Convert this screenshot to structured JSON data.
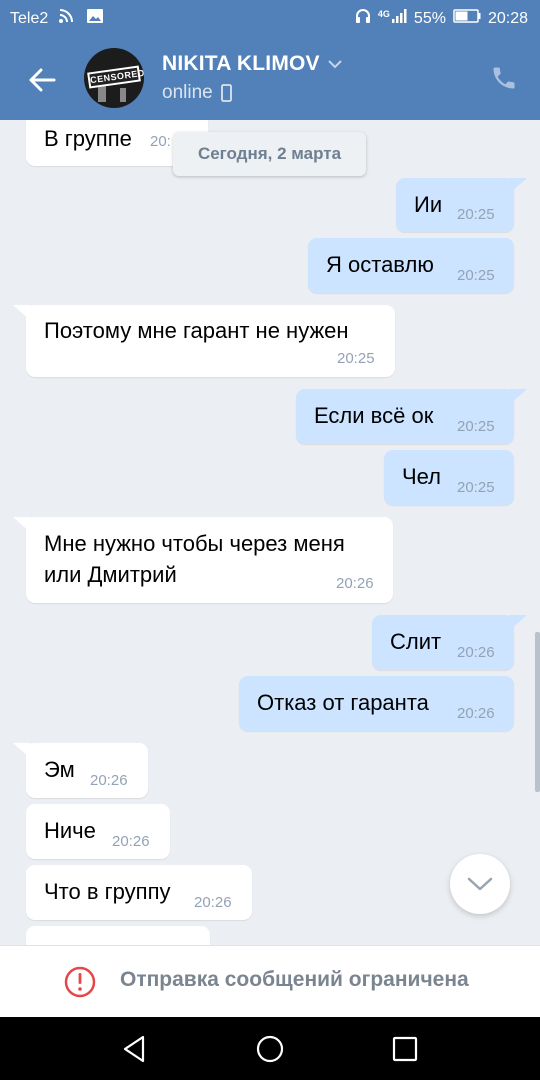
{
  "status_bar": {
    "carrier": "Tele2",
    "network": "4G",
    "battery": "55%",
    "time": "20:28",
    "icons": [
      "wifi-icon",
      "image-icon",
      "headset-icon",
      "signal-icon",
      "battery-icon"
    ]
  },
  "header": {
    "name": "NIKITA KLIMOV",
    "status": "online",
    "avatar_stamp": "CENSORED",
    "icons": [
      "back-arrow-icon",
      "chevron-down-icon",
      "mobile-device-icon",
      "phone-icon"
    ]
  },
  "chat": {
    "date_chip": "Сегодня, 2 марта",
    "messages": [
      {
        "dir": "in",
        "text": "В группе",
        "time": "20:"
      },
      {
        "dir": "out",
        "text": "Ии",
        "time": "20:25"
      },
      {
        "dir": "out",
        "text": "Я оставлю",
        "time": "20:25"
      },
      {
        "dir": "in",
        "text": "Поэтому мне гарант не нужен",
        "time": "20:25"
      },
      {
        "dir": "out",
        "text": "Если всё ок",
        "time": "20:25"
      },
      {
        "dir": "out",
        "text": "Чел",
        "time": "20:25"
      },
      {
        "dir": "in",
        "text_line1": "Мне нужно чтобы через меня",
        "text_line2": "или Дмитрий",
        "time": "20:26"
      },
      {
        "dir": "out",
        "text": "Слит",
        "time": "20:26"
      },
      {
        "dir": "out",
        "text": "Отказ от гаранта",
        "time": "20:26"
      },
      {
        "dir": "in",
        "text": "Эм",
        "time": "20:26"
      },
      {
        "dir": "in",
        "text": "Ниче",
        "time": "20:26"
      },
      {
        "dir": "in",
        "text": "Что в группу",
        "time": "20:26"
      }
    ]
  },
  "restriction": {
    "text": "Отправка сообщений ограничена",
    "icon": "warning-icon"
  },
  "navbar": {
    "icons": [
      "nav-back-icon",
      "nav-home-icon",
      "nav-recents-icon"
    ]
  },
  "colors": {
    "header_bg": "#5181b8",
    "chat_bg": "#ebeef2",
    "incoming_bubble": "#ffffff",
    "outgoing_bubble": "#cce4ff",
    "warning": "#e64646"
  }
}
